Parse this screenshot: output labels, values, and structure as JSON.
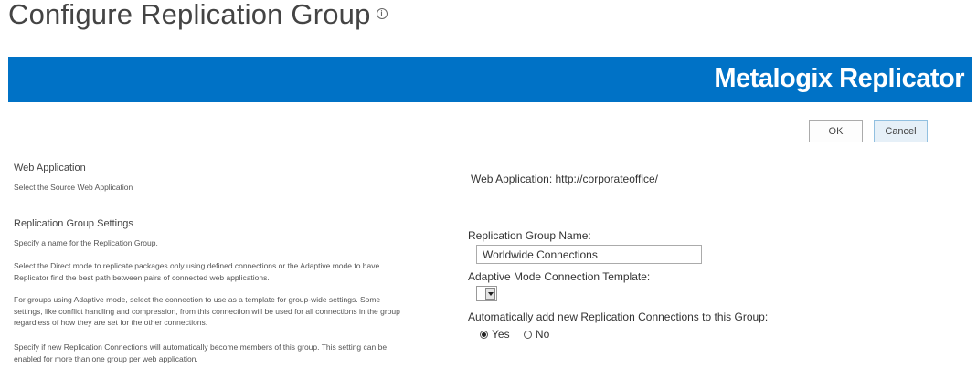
{
  "header": {
    "title": "Configure Replication Group",
    "info_icon": "i"
  },
  "banner": {
    "brand": "Metalogix Replicator",
    "color": "#0072c6"
  },
  "toolbar": {
    "ok_label": "OK",
    "cancel_label": "Cancel"
  },
  "sections": {
    "web_application": {
      "title": "Web Application",
      "description": "Select the Source Web Application",
      "value_text": "Web Application: http://corporateoffice/"
    },
    "replication_group_settings": {
      "title": "Replication Group Settings",
      "descriptions": [
        "Specify a name for the Replication Group.",
        "Select the Direct mode to replicate packages only using defined connections or the Adaptive mode to have Replicator find the best path between pairs of connected web applications.",
        "For groups using Adaptive mode, select the connection to use as a template for group-wide settings. Some settings, like conflict handling and compression, from this connection will be used for all connections in the group regardless of how they are set for the other connections.",
        "Specify if new Replication Connections will automatically become members of this group. This setting can be enabled for more than one group per web application."
      ]
    }
  },
  "form": {
    "group_name_label": "Replication Group Name:",
    "group_name_value": "Worldwide Connections",
    "template_label": "Adaptive Mode Connection Template:",
    "template_value": "",
    "auto_add_label": "Automatically add new Replication Connections to this Group:",
    "auto_add_options": [
      "Yes",
      "No"
    ],
    "auto_add_selected": "Yes"
  }
}
